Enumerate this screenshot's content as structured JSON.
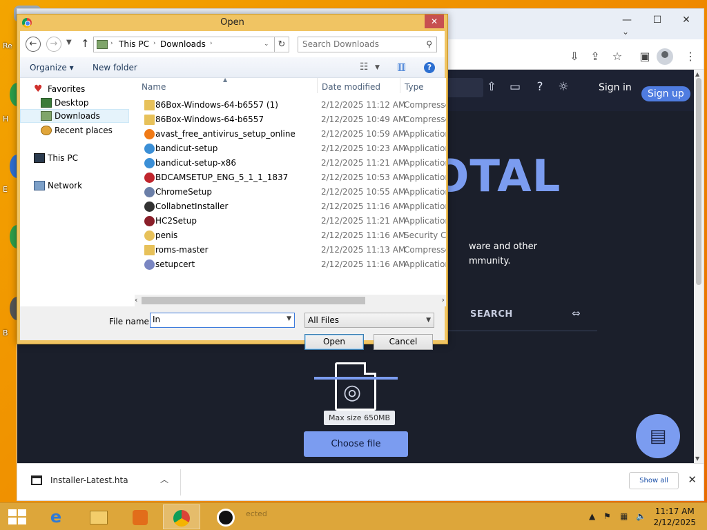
{
  "desktop": {
    "icon_labels": [
      "Re",
      "H",
      "E",
      "B"
    ]
  },
  "chrome": {
    "window_controls": {
      "minimize": "—",
      "maximize": "☐",
      "close": "✕"
    },
    "tab_dropdown": "⌄"
  },
  "site": {
    "header": {
      "sign_in": "Sign in",
      "sign_up": "Sign up"
    },
    "logo_text": "OTAL",
    "description_lines": [
      "ware and other",
      "mmunity."
    ],
    "tab_search": "SEARCH",
    "max_size": "Max size 650MB",
    "choose_file": "Choose file"
  },
  "dialog": {
    "title": "Open",
    "breadcrumb": [
      "This PC",
      "Downloads"
    ],
    "search_placeholder": "Search Downloads",
    "toolbar": {
      "organize": "Organize ▾",
      "new_folder": "New folder"
    },
    "nav_pane": {
      "favorites": "Favorites",
      "desktop": "Desktop",
      "downloads": "Downloads",
      "recent": "Recent places",
      "this_pc": "This PC",
      "network": "Network"
    },
    "columns": {
      "name": "Name",
      "date": "Date modified",
      "type": "Type"
    },
    "files": [
      {
        "name": "86Box-Windows-64-b6557 (1)",
        "date": "2/12/2025 11:12 AM",
        "type": "Compressed",
        "icon": "zip-folder-icon",
        "color": "#e7c15a"
      },
      {
        "name": "86Box-Windows-64-b6557",
        "date": "2/12/2025 10:49 AM",
        "type": "Compressed",
        "icon": "zip-folder-icon",
        "color": "#e7c15a"
      },
      {
        "name": "avast_free_antivirus_setup_online",
        "date": "2/12/2025 10:59 AM",
        "type": "Application",
        "icon": "avast-icon",
        "color": "#f07a16"
      },
      {
        "name": "bandicut-setup",
        "date": "2/12/2025 10:23 AM",
        "type": "Application",
        "icon": "bandicut-icon",
        "color": "#3b8fd6"
      },
      {
        "name": "bandicut-setup-x86",
        "date": "2/12/2025 11:21 AM",
        "type": "Application",
        "icon": "bandicut-icon",
        "color": "#3b8fd6"
      },
      {
        "name": "BDCAMSETUP_ENG_5_1_1_1837",
        "date": "2/12/2025 10:53 AM",
        "type": "Application",
        "icon": "bdcam-icon",
        "color": "#c0262d"
      },
      {
        "name": "ChromeSetup",
        "date": "2/12/2025 10:55 AM",
        "type": "Application",
        "icon": "installer-icon",
        "color": "#6b7fa8"
      },
      {
        "name": "CollabnetInstaller",
        "date": "2/12/2025 11:16 AM",
        "type": "Application",
        "icon": "collabnet-icon",
        "color": "#333333"
      },
      {
        "name": "HC2Setup",
        "date": "2/12/2025 11:21 AM",
        "type": "Application",
        "icon": "hc2-icon",
        "color": "#8a1f2a"
      },
      {
        "name": "penis",
        "date": "2/12/2025 11:16 AM",
        "type": "Security Ce",
        "icon": "certificate-icon",
        "color": "#e7c15a"
      },
      {
        "name": "roms-master",
        "date": "2/12/2025 11:13 AM",
        "type": "Compressed",
        "icon": "zip-folder-icon",
        "color": "#e7c15a"
      },
      {
        "name": "setupcert",
        "date": "2/12/2025 11:16 AM",
        "type": "Application",
        "icon": "setup-icon",
        "color": "#7a86c2"
      }
    ],
    "file_name_label": "File name:",
    "file_name_value": "In",
    "file_type": "All Files",
    "open_button": "Open",
    "cancel_button": "Cancel"
  },
  "downloads_bar": {
    "file": "Installer-Latest.hta",
    "show_all": "Show all"
  },
  "taskbar": {
    "ghost_text": "ected",
    "clock_time": "11:17 AM",
    "clock_date": "2/12/2025"
  }
}
